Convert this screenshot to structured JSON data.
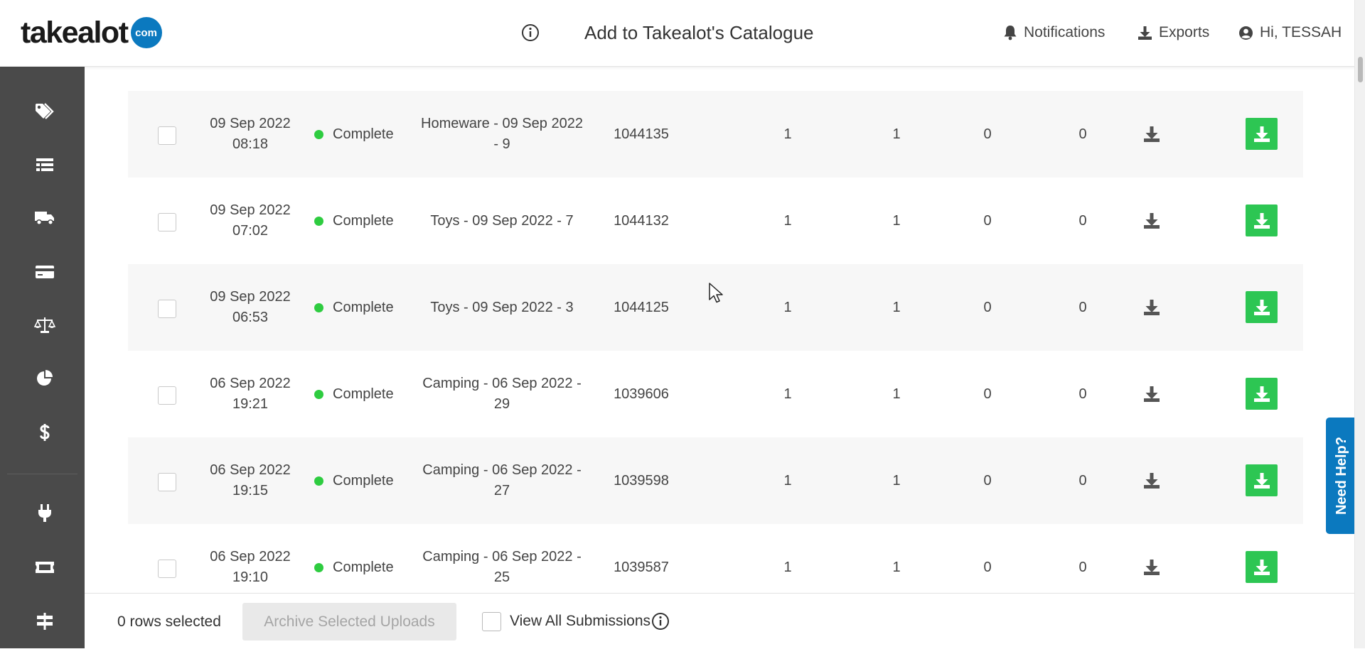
{
  "header": {
    "logo_text": "takealot",
    "logo_badge": "com",
    "title": "Add to Takealot's Catalogue",
    "info_icon": "info-circle-icon",
    "notifications_label": "Notifications",
    "exports_label": "Exports",
    "user_label": "Hi, TESSAH"
  },
  "sidebar": {
    "items": [
      {
        "icon": "tags-icon"
      },
      {
        "icon": "list-icon"
      },
      {
        "icon": "truck-icon"
      },
      {
        "icon": "credit-card-icon"
      },
      {
        "icon": "balance-scale-icon"
      },
      {
        "icon": "pie-chart-icon"
      },
      {
        "icon": "dollar-icon"
      },
      {
        "icon": "plug-icon"
      },
      {
        "icon": "ticket-icon"
      },
      {
        "icon": "signpost-icon"
      }
    ]
  },
  "table": {
    "rows": [
      {
        "date": "09 Sep 2022",
        "time": "08:18",
        "status": "Complete",
        "name": "Homeware - 09 Sep 2022 - 9",
        "id": "1044135",
        "c1": "1",
        "c2": "1",
        "c3": "0",
        "c4": "0"
      },
      {
        "date": "09 Sep 2022",
        "time": "07:02",
        "status": "Complete",
        "name": "Toys - 09 Sep 2022 - 7",
        "id": "1044132",
        "c1": "1",
        "c2": "1",
        "c3": "0",
        "c4": "0"
      },
      {
        "date": "09 Sep 2022",
        "time": "06:53",
        "status": "Complete",
        "name": "Toys - 09 Sep 2022 - 3",
        "id": "1044125",
        "c1": "1",
        "c2": "1",
        "c3": "0",
        "c4": "0"
      },
      {
        "date": "06 Sep 2022",
        "time": "19:21",
        "status": "Complete",
        "name": "Camping - 06 Sep 2022 - 29",
        "id": "1039606",
        "c1": "1",
        "c2": "1",
        "c3": "0",
        "c4": "0"
      },
      {
        "date": "06 Sep 2022",
        "time": "19:15",
        "status": "Complete",
        "name": "Camping - 06 Sep 2022 - 27",
        "id": "1039598",
        "c1": "1",
        "c2": "1",
        "c3": "0",
        "c4": "0"
      },
      {
        "date": "06 Sep 2022",
        "time": "19:10",
        "status": "Complete",
        "name": "Camping - 06 Sep 2022 - 25",
        "id": "1039587",
        "c1": "1",
        "c2": "1",
        "c3": "0",
        "c4": "0"
      }
    ]
  },
  "footer": {
    "rows_selected": "0 rows selected",
    "archive_label": "Archive Selected Uploads",
    "view_all_label": "View All Submissions"
  },
  "help": {
    "label": "Need Help?"
  },
  "colors": {
    "brand_blue": "#0b79bf",
    "status_green": "#2ecc40",
    "download_green": "#2dc653",
    "sidebar_bg": "#4a4a4a"
  }
}
